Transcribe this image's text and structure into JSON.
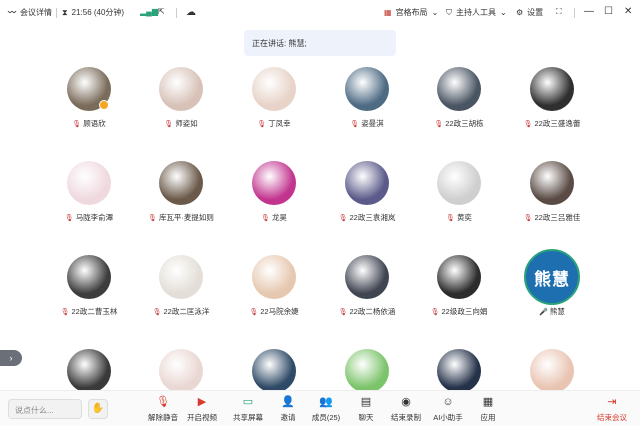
{
  "topbar": {
    "meeting_details": "会议详情",
    "duration": "21:56 (40分钟)",
    "grid_layout": "宫格布局",
    "host_tools": "主持人工具",
    "settings": "设置"
  },
  "speaking_notice": "正在讲话: 熊慧;",
  "participants": [
    {
      "name": "顾语欣",
      "mic": "muted",
      "color": "#7a6b5a"
    },
    {
      "name": "师姿如",
      "mic": "muted",
      "color": "#d8c2b8"
    },
    {
      "name": "丁凤幸",
      "mic": "muted",
      "color": "#e7d3c8"
    },
    {
      "name": "姿曼淇",
      "mic": "muted",
      "color": "#4e6b84"
    },
    {
      "name": "22政三胡栋",
      "mic": "muted",
      "color": "#4a5563"
    },
    {
      "name": "22政三盛逸蕾",
      "mic": "muted",
      "color": "#2f2f2f"
    },
    {
      "name": "马陇李俞潭",
      "mic": "muted",
      "color": "#efd9df"
    },
    {
      "name": "库瓦平·麦提如则",
      "mic": "muted",
      "color": "#6b5a4a"
    },
    {
      "name": "龙昊",
      "mic": "muted",
      "color": "#c2358f"
    },
    {
      "name": "22政三袁湘岚",
      "mic": "muted",
      "color": "#5b5a8a"
    },
    {
      "name": "黄奕",
      "mic": "muted",
      "color": "#cfcfcf"
    },
    {
      "name": "22政三吕雅佳",
      "mic": "muted",
      "color": "#5a4b45"
    },
    {
      "name": "22政二曹玉林",
      "mic": "muted",
      "color": "#3d3d3d"
    },
    {
      "name": "22政二匡泳洋",
      "mic": "muted",
      "color": "#e3ded7"
    },
    {
      "name": "22马院余婕",
      "mic": "muted",
      "color": "#e6c8b0"
    },
    {
      "name": "22政二杨依涵",
      "mic": "muted",
      "color": "#404552"
    },
    {
      "name": "22级政三向娟",
      "mic": "muted",
      "color": "#2c2c2c"
    },
    {
      "name": "熊慧",
      "mic": "on",
      "text_avatar": "熊慧",
      "color": "#1e6fb0"
    },
    {
      "name": "",
      "mic": "",
      "color": "#3a3a3a"
    },
    {
      "name": "",
      "mic": "",
      "color": "#e9d7d3"
    },
    {
      "name": "",
      "mic": "",
      "color": "#2e4a66"
    },
    {
      "name": "",
      "mic": "",
      "color": "#7cc46b"
    },
    {
      "name": "",
      "mic": "",
      "color": "#25324a"
    },
    {
      "name": "",
      "mic": "",
      "color": "#e9c4b3"
    }
  ],
  "bottombar": {
    "chat_placeholder": "说点什么...",
    "unmute": "解除静音",
    "start_video": "开启视频",
    "share_screen": "共享屏幕",
    "invite": "邀请",
    "members": "成员(25)",
    "chat": "聊天",
    "record": "结束录制",
    "ai_assistant": "AI小助手",
    "apps": "应用",
    "end_meeting": "结束会议"
  }
}
